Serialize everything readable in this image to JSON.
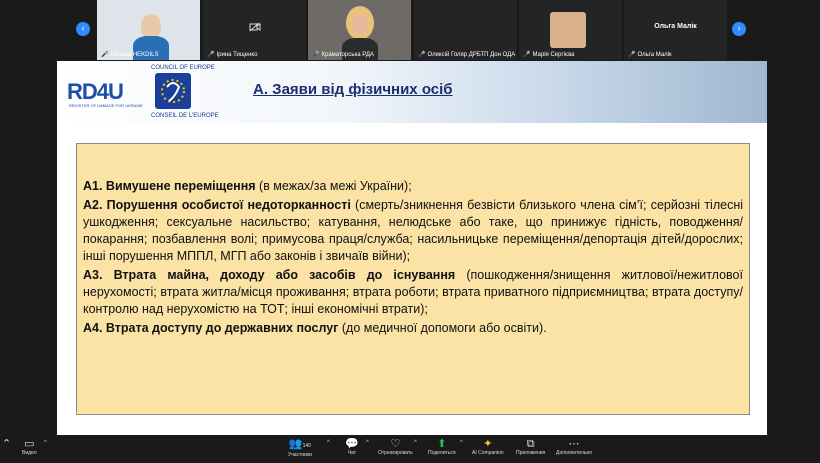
{
  "gallery": {
    "participants": [
      {
        "name": "Oksana HEKDILS"
      },
      {
        "name": "Ірина Тищенко"
      },
      {
        "name": "Краматорська РДА"
      },
      {
        "name": "Олексій Голяр ДРБТП Дон ОДА"
      },
      {
        "name": "Марія Сергієва"
      },
      {
        "name": "Ольга Малік"
      }
    ],
    "center_name": "Ольга Малік",
    "prev_icon": "chevron-left-icon",
    "next_icon": "chevron-right-icon"
  },
  "slide": {
    "logo_rd4u": "RD4U",
    "logo_rd4u_sub": "REGISTER OF DAMAGE FOR UKRAINE",
    "logo_coe_top": "COUNCIL OF EUROPE",
    "logo_coe_bottom": "CONSEIL DE L'EUROPE",
    "title": "А. Заяви від фізичних осіб",
    "items": [
      {
        "head": "А1. Вимушене переміщення",
        "body": " (в межах/за межі України);"
      },
      {
        "head": "А2. Порушення особистої недоторканності",
        "body": " (смерть/зникнення безвісти близького члена сім’ї; серйозні тілесні ушкодження; сексуальне насильство; катування, нелюдське або таке, що принижує гідність, поводження/покарання; позбавлення волі; примусова праця/служба; насильницьке переміщення/депортація дітей/дорослих; інші порушення МППЛ, МГП або законів і звичаїв війни);"
      },
      {
        "head": "А3. Втрата майна, доходу або засобів до існування",
        "body": " (пошкодження/знищення житлової/нежитлової нерухомості; втрата житла/місця проживання; втрата роботи; втрата приватного підприємництва; втрата доступу/контролю над нерухомістю на ТОТ; інші економічні втрати);"
      },
      {
        "head": "А4. Втрата доступу до державних послуг",
        "body": " (до медичної допомоги або освіти)."
      }
    ]
  },
  "toolbar": {
    "video": "Видео",
    "participants": "Участники",
    "participants_count": "140",
    "chat": "Чат",
    "react": "Отреагировать",
    "share": "Поделиться",
    "ai": "AI Companion",
    "apps": "Приложения",
    "more": "Дополнительно"
  }
}
